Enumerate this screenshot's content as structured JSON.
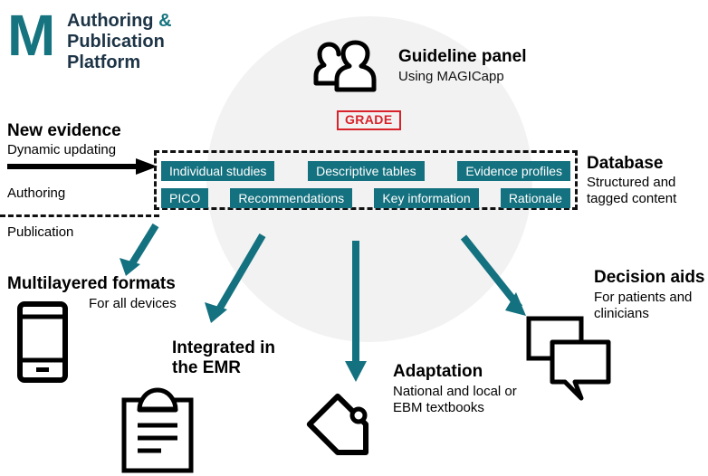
{
  "colors": {
    "teal": "#14717f",
    "teal_dark": "#15747f",
    "navy": "#1d3446",
    "red": "#d8232a",
    "circle_bg": "#f2f2f2",
    "black": "#111111",
    "white": "#ffffff"
  },
  "logo": {
    "mark": "M",
    "line1": "Authoring ",
    "ampersand": "&",
    "line2": "Publication",
    "line3": "Platform"
  },
  "guideline_panel": {
    "title": "Guideline panel",
    "subtitle": "Using MAGICapp",
    "badge": "GRADE",
    "icon": "two-people-icon"
  },
  "left_flow": {
    "new_evidence_title": "New evidence",
    "new_evidence_sub": "Dynamic updating",
    "authoring": "Authoring",
    "publication": "Publication",
    "arrow_icon": "black-right-arrow-icon"
  },
  "database": {
    "title": "Database",
    "subtitle": "Structured and tagged content",
    "row1": [
      "Individual studies",
      "Descriptive tables",
      "Evidence profiles"
    ],
    "row2": [
      "PICO",
      "Recommendations",
      "Key information",
      "Rationale"
    ]
  },
  "outputs": [
    {
      "key": "multilayered",
      "title": "Multilayered formats",
      "subtitle": "For all devices",
      "icon": "smartphone-icon"
    },
    {
      "key": "emr",
      "title": "Integrated in the EMR",
      "subtitle": "",
      "icon": "clipboard-icon"
    },
    {
      "key": "adaptation",
      "title": "Adaptation",
      "subtitle": "National and local or EBM textbooks",
      "icon": "tag-icon"
    },
    {
      "key": "decision_aids",
      "title": "Decision aids",
      "subtitle": "For patients and clinicians",
      "icon": "speech-bubbles-icon"
    }
  ],
  "arrows": {
    "count": 4,
    "color": "#14717f",
    "description": "four teal arrows from the database to the four output formats"
  }
}
